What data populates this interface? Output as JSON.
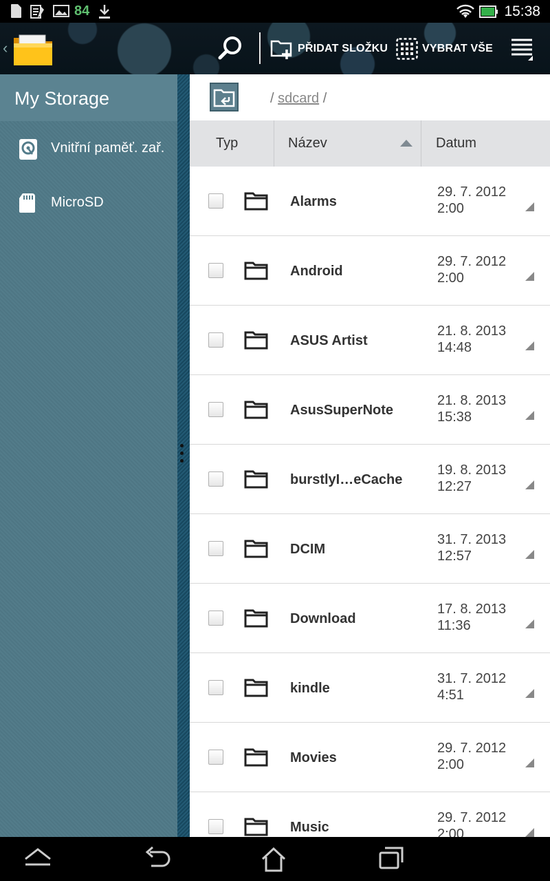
{
  "status_bar": {
    "icons": [
      "sd-card-icon",
      "notes-icon",
      "gallery-icon",
      "download-icon",
      "wifi-icon",
      "battery-icon"
    ],
    "battery_number": "84",
    "time": "15:38"
  },
  "action_bar": {
    "add_folder_label": "PŘIDAT SLOŽKU",
    "select_all_label": "VYBRAT VŠE"
  },
  "sidebar": {
    "title": "My Storage",
    "items": [
      {
        "label": "Vnitřní paměť. zař."
      },
      {
        "label": "MicroSD"
      }
    ]
  },
  "path": {
    "prefix": "/ ",
    "segment": "sdcard",
    "suffix": " /"
  },
  "table": {
    "headers": {
      "type": "Typ",
      "name": "Název",
      "date": "Datum"
    },
    "rows": [
      {
        "name": "Alarms",
        "date": "29. 7. 2012 2:00"
      },
      {
        "name": "Android",
        "date": "29. 7. 2012 2:00"
      },
      {
        "name": "ASUS Artist",
        "date": "21. 8. 2013 14:48"
      },
      {
        "name": "AsusSuperNote",
        "date": "21. 8. 2013 15:38"
      },
      {
        "name": "burstlyI…eCache",
        "date": "19. 8. 2013 12:27"
      },
      {
        "name": "DCIM",
        "date": "31. 7. 2013 12:57"
      },
      {
        "name": "Download",
        "date": "17. 8. 2013 11:36"
      },
      {
        "name": "kindle",
        "date": "31. 7. 2012 4:51"
      },
      {
        "name": "Movies",
        "date": "29. 7. 2012 2:00"
      },
      {
        "name": "Music",
        "date": "29. 7. 2012 2:00"
      }
    ]
  },
  "colors": {
    "sidebar": "#537c8a",
    "sidebar_edge": "#1f5470",
    "header_bg": "#e1e2e4",
    "battery": "#5fbf6f"
  }
}
